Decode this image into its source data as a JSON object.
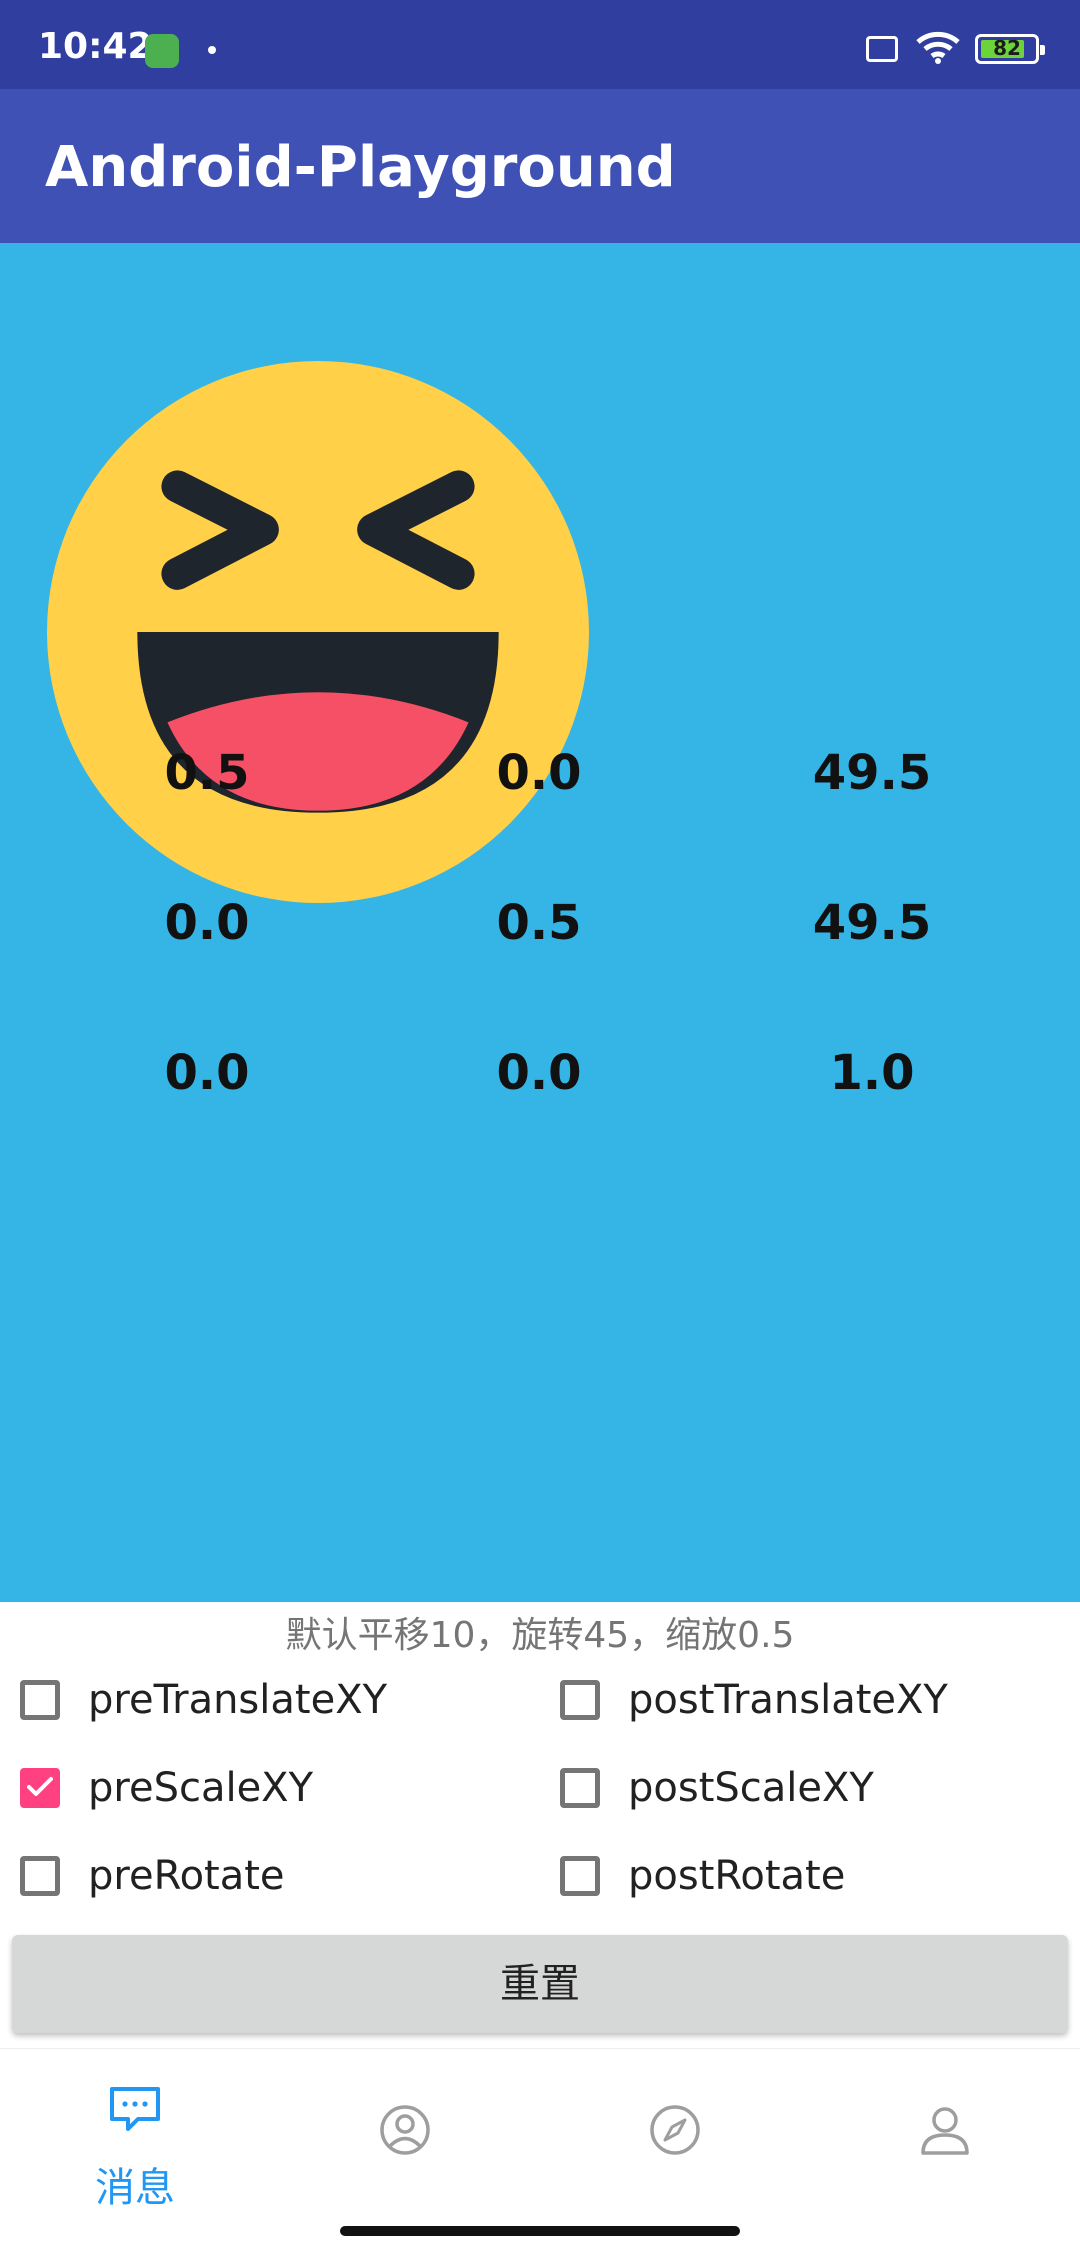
{
  "status_bar": {
    "time": "10:42",
    "battery": "82",
    "icons": [
      "app-notification-icon",
      "dot-icon",
      "sim-x-icon",
      "wifi-icon",
      "battery-icon"
    ]
  },
  "app_bar": {
    "title": "Android-Playground"
  },
  "canvas": {
    "background": "#35B5E5",
    "image": "laughing-emoji",
    "matrix": [
      [
        "0.5",
        "0.0",
        "49.5"
      ],
      [
        "0.0",
        "0.5",
        "49.5"
      ],
      [
        "0.0",
        "0.0",
        "1.0"
      ]
    ]
  },
  "hint": "默认平移10，旋转45，缩放0.5",
  "options": [
    {
      "label": "preTranslateXY",
      "checked": false
    },
    {
      "label": "postTranslateXY",
      "checked": false
    },
    {
      "label": "preScaleXY",
      "checked": true
    },
    {
      "label": "postScaleXY",
      "checked": false
    },
    {
      "label": "preRotate",
      "checked": false
    },
    {
      "label": "postRotate",
      "checked": false
    }
  ],
  "reset_button": "重置",
  "bottom_nav": {
    "items": [
      {
        "icon": "message-icon",
        "label": "消息",
        "active": true
      },
      {
        "icon": "contacts-icon",
        "label": "",
        "active": false
      },
      {
        "icon": "compass-icon",
        "label": "",
        "active": false
      },
      {
        "icon": "profile-icon",
        "label": "",
        "active": false
      }
    ]
  },
  "colors": {
    "primary": "#3F51B5",
    "primary_dark": "#303F9F",
    "accent": "#FF4081",
    "nav_active": "#2196F3"
  }
}
